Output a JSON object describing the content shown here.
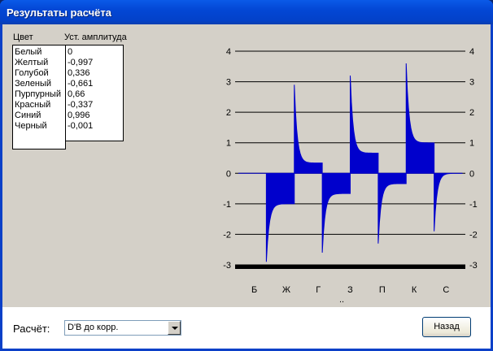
{
  "window": {
    "title": "Результаты расчёта"
  },
  "table": {
    "color_header": "Цвет",
    "amplitude_header": "Уст. амплитуда",
    "colors": [
      "Белый",
      "Желтый",
      "Голубой",
      "Зеленый",
      "Пурпурный",
      "Красный",
      "Синий",
      "Черный"
    ],
    "amplitudes": [
      "0",
      "-0,997",
      "0,336",
      "-0,661",
      "0,66",
      "-0,337",
      "0,996",
      "-0,001"
    ]
  },
  "bottom": {
    "calc_label": "Расчёт:",
    "calc_value": "D'B до корр.",
    "back_label": "Назад"
  },
  "colors": {
    "series": "#0000cc",
    "title_bar": "#0347d5",
    "panel": "#d4d0c8"
  },
  "chart_data": {
    "type": "area",
    "categories": [
      "Б",
      "Ж",
      "Г",
      "З",
      "П",
      "К",
      "С"
    ],
    "categories_note": "..",
    "ylim": [
      -3,
      4
    ],
    "yticks": [
      "4",
      "3",
      "2",
      "1",
      "0",
      "-1",
      "-2",
      "-3"
    ],
    "grid": true,
    "series": [
      {
        "color": "#0000cc",
        "steady_values": [
          0,
          -0.997,
          0.336,
          -0.661,
          0.66,
          -0.337,
          0.996,
          -0.001
        ],
        "peak_values": [
          0,
          -2.9,
          2.9,
          -2.6,
          3.2,
          -2.3,
          3.6,
          -1.9
        ]
      }
    ]
  }
}
